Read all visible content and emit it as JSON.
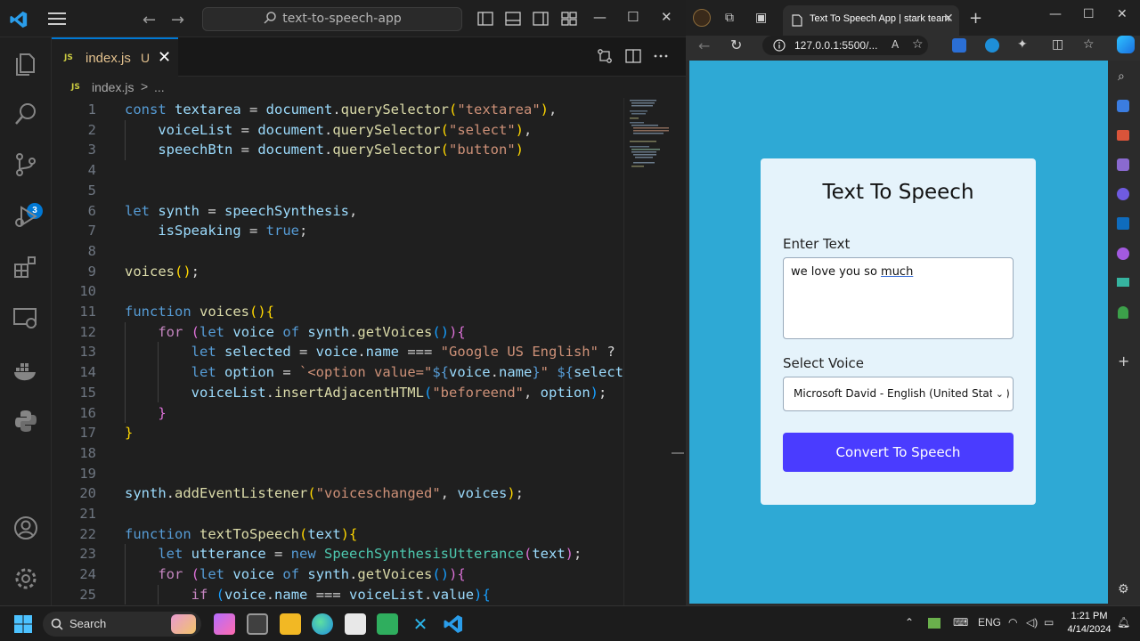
{
  "vscode": {
    "command_center": "text-to-speech-app",
    "source_control_badge": "3",
    "tab": {
      "file_badge": "JS",
      "file_name": "index.js",
      "modified_flag": "U"
    },
    "breadcrumb": {
      "file_badge": "JS",
      "file": "index.js",
      "separator": ">",
      "more": "..."
    },
    "window_controls": {
      "minimize": "—",
      "maximize": "☐",
      "close": "✕"
    },
    "code": [
      {
        "n": "1"
      },
      {
        "n": "2"
      },
      {
        "n": "3"
      },
      {
        "n": "4"
      },
      {
        "n": "5"
      },
      {
        "n": "6"
      },
      {
        "n": "7"
      },
      {
        "n": "8"
      },
      {
        "n": "9"
      },
      {
        "n": "10"
      },
      {
        "n": "11"
      },
      {
        "n": "12"
      },
      {
        "n": "13"
      },
      {
        "n": "14"
      },
      {
        "n": "15"
      },
      {
        "n": "16"
      },
      {
        "n": "17"
      },
      {
        "n": "18"
      },
      {
        "n": "19"
      },
      {
        "n": "20"
      },
      {
        "n": "21"
      },
      {
        "n": "22"
      },
      {
        "n": "23"
      },
      {
        "n": "24"
      },
      {
        "n": "25"
      }
    ],
    "code_text": [
      [
        [
          "k",
          "const"
        ],
        [
          "o",
          " "
        ],
        [
          "v",
          "textarea"
        ],
        [
          "o",
          " = "
        ],
        [
          "v",
          "document"
        ],
        [
          "o",
          "."
        ],
        [
          "f",
          "querySelector"
        ],
        [
          "p",
          "("
        ],
        [
          "s",
          "\"textarea\""
        ],
        [
          "p",
          ")"
        ],
        [
          "o",
          ","
        ]
      ],
      [
        [
          "o",
          "    "
        ],
        [
          "v",
          "voiceList"
        ],
        [
          "o",
          " = "
        ],
        [
          "v",
          "document"
        ],
        [
          "o",
          "."
        ],
        [
          "f",
          "querySelector"
        ],
        [
          "p",
          "("
        ],
        [
          "s",
          "\"select\""
        ],
        [
          "p",
          ")"
        ],
        [
          "o",
          ","
        ]
      ],
      [
        [
          "o",
          "    "
        ],
        [
          "v",
          "speechBtn"
        ],
        [
          "o",
          " = "
        ],
        [
          "v",
          "document"
        ],
        [
          "o",
          "."
        ],
        [
          "f",
          "querySelector"
        ],
        [
          "p",
          "("
        ],
        [
          "s",
          "\"button\""
        ],
        [
          "p",
          ")"
        ]
      ],
      [],
      [],
      [
        [
          "k",
          "let"
        ],
        [
          "o",
          " "
        ],
        [
          "v",
          "synth"
        ],
        [
          "o",
          " = "
        ],
        [
          "v",
          "speechSynthesis"
        ],
        [
          "o",
          ","
        ]
      ],
      [
        [
          "o",
          "    "
        ],
        [
          "v",
          "isSpeaking"
        ],
        [
          "o",
          " = "
        ],
        [
          "k",
          "true"
        ],
        [
          "o",
          ";"
        ]
      ],
      [],
      [
        [
          "f",
          "voices"
        ],
        [
          "p",
          "()"
        ],
        [
          "o",
          ";"
        ]
      ],
      [],
      [
        [
          "k",
          "function"
        ],
        [
          "o",
          " "
        ],
        [
          "f",
          "voices"
        ],
        [
          "p",
          "()"
        ],
        [
          "p",
          "{"
        ]
      ],
      [
        [
          "o",
          "    "
        ],
        [
          "kc",
          "for"
        ],
        [
          "o",
          " "
        ],
        [
          "p2",
          "("
        ],
        [
          "k",
          "let"
        ],
        [
          "o",
          " "
        ],
        [
          "v",
          "voice"
        ],
        [
          "o",
          " "
        ],
        [
          "k",
          "of"
        ],
        [
          "o",
          " "
        ],
        [
          "v",
          "synth"
        ],
        [
          "o",
          "."
        ],
        [
          "f",
          "getVoices"
        ],
        [
          "p3",
          "()"
        ],
        [
          "p2",
          ")"
        ],
        [
          "p2",
          "{"
        ]
      ],
      [
        [
          "o",
          "        "
        ],
        [
          "k",
          "let"
        ],
        [
          "o",
          " "
        ],
        [
          "v",
          "selected"
        ],
        [
          "o",
          " = "
        ],
        [
          "v",
          "voice"
        ],
        [
          "o",
          "."
        ],
        [
          "v",
          "name"
        ],
        [
          "o",
          " === "
        ],
        [
          "s",
          "\"Google US English\""
        ],
        [
          "o",
          " ? "
        ],
        [
          "s",
          "\""
        ]
      ],
      [
        [
          "o",
          "        "
        ],
        [
          "k",
          "let"
        ],
        [
          "o",
          " "
        ],
        [
          "v",
          "option"
        ],
        [
          "o",
          " = "
        ],
        [
          "s",
          "`<option value=\""
        ],
        [
          "k",
          "${"
        ],
        [
          "v",
          "voice"
        ],
        [
          "o",
          "."
        ],
        [
          "v",
          "name"
        ],
        [
          "k",
          "}"
        ],
        [
          "s",
          "\" "
        ],
        [
          "k",
          "${"
        ],
        [
          "v",
          "selecte"
        ]
      ],
      [
        [
          "o",
          "        "
        ],
        [
          "v",
          "voiceList"
        ],
        [
          "o",
          "."
        ],
        [
          "f",
          "insertAdjacentHTML"
        ],
        [
          "p3",
          "("
        ],
        [
          "s",
          "\"beforeend\""
        ],
        [
          "o",
          ", "
        ],
        [
          "v",
          "option"
        ],
        [
          "p3",
          ")"
        ],
        [
          "o",
          ";"
        ]
      ],
      [
        [
          "o",
          "    "
        ],
        [
          "p2",
          "}"
        ]
      ],
      [
        [
          "p",
          "}"
        ]
      ],
      [],
      [],
      [
        [
          "v",
          "synth"
        ],
        [
          "o",
          "."
        ],
        [
          "f",
          "addEventListener"
        ],
        [
          "p",
          "("
        ],
        [
          "s",
          "\"voiceschanged\""
        ],
        [
          "o",
          ", "
        ],
        [
          "v",
          "voices"
        ],
        [
          "p",
          ")"
        ],
        [
          "o",
          ";"
        ]
      ],
      [],
      [
        [
          "k",
          "function"
        ],
        [
          "o",
          " "
        ],
        [
          "f",
          "textToSpeech"
        ],
        [
          "p",
          "("
        ],
        [
          "v",
          "text"
        ],
        [
          "p",
          ")"
        ],
        [
          "p",
          "{"
        ]
      ],
      [
        [
          "o",
          "    "
        ],
        [
          "k",
          "let"
        ],
        [
          "o",
          " "
        ],
        [
          "v",
          "utterance"
        ],
        [
          "o",
          " = "
        ],
        [
          "k",
          "new"
        ],
        [
          "o",
          " "
        ],
        [
          "t",
          "SpeechSynthesisUtterance"
        ],
        [
          "p2",
          "("
        ],
        [
          "v",
          "text"
        ],
        [
          "p2",
          ")"
        ],
        [
          "o",
          ";"
        ]
      ],
      [
        [
          "o",
          "    "
        ],
        [
          "kc",
          "for"
        ],
        [
          "o",
          " "
        ],
        [
          "p2",
          "("
        ],
        [
          "k",
          "let"
        ],
        [
          "o",
          " "
        ],
        [
          "v",
          "voice"
        ],
        [
          "o",
          " "
        ],
        [
          "k",
          "of"
        ],
        [
          "o",
          " "
        ],
        [
          "v",
          "synth"
        ],
        [
          "o",
          "."
        ],
        [
          "f",
          "getVoices"
        ],
        [
          "p3",
          "()"
        ],
        [
          "p2",
          ")"
        ],
        [
          "p2",
          "{"
        ]
      ],
      [
        [
          "o",
          "        "
        ],
        [
          "kc",
          "if"
        ],
        [
          "o",
          " "
        ],
        [
          "p3",
          "("
        ],
        [
          "v",
          "voice"
        ],
        [
          "o",
          "."
        ],
        [
          "v",
          "name"
        ],
        [
          "o",
          " === "
        ],
        [
          "v",
          "voiceList"
        ],
        [
          "o",
          "."
        ],
        [
          "v",
          "value"
        ],
        [
          "p3",
          ")"
        ],
        [
          "p3",
          "{"
        ]
      ]
    ]
  },
  "browser": {
    "tab_title": "Text To Speech App | stark team",
    "tab_close": "✕",
    "new_tab": "+",
    "url": "127.0.0.1:5500/...",
    "window_controls": {
      "minimize": "—",
      "maximize": "☐",
      "close": "✕"
    },
    "page": {
      "title": "Text To Speech",
      "text_label": "Enter Text",
      "textarea_value_prefix": "we love you so ",
      "textarea_value_underlined": "much",
      "voice_label": "Select Voice",
      "voice_selected": "Microsoft David - English (United States)",
      "button_label": "Convert To Speech"
    },
    "colors": {
      "page_bg": "#2ea9d5",
      "card_bg": "#e5f3fb",
      "button_bg": "#4a3cff"
    }
  },
  "taskbar": {
    "search_placeholder": "Search",
    "language": "ENG",
    "time": "1:21 PM",
    "date": "4/14/2024"
  }
}
